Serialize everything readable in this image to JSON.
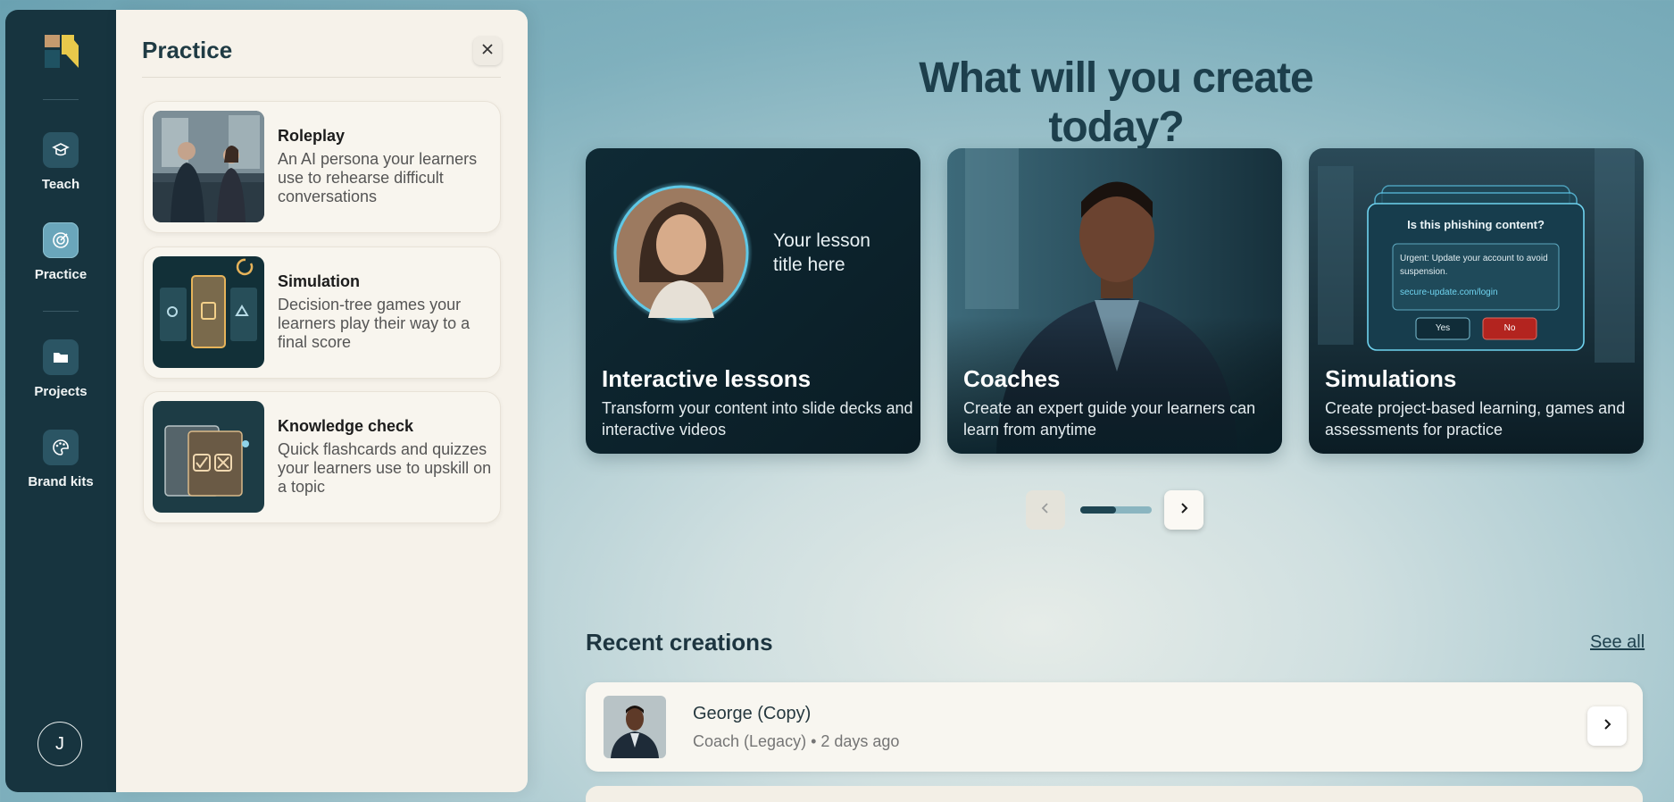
{
  "rail": {
    "items": [
      {
        "label": "Teach",
        "icon": "mortarboard-icon"
      },
      {
        "label": "Practice",
        "icon": "target-icon"
      },
      {
        "label": "Projects",
        "icon": "folder-icon"
      },
      {
        "label": "Brand kits",
        "icon": "palette-icon"
      }
    ],
    "active": "Practice",
    "avatar_initial": "J"
  },
  "panel": {
    "title": "Practice",
    "options": [
      {
        "title": "Roleplay",
        "desc": "An AI persona your learners use to rehearse difficult conversations"
      },
      {
        "title": "Simulation",
        "desc": "Decision-tree games your learners play their way to a final score"
      },
      {
        "title": "Knowledge check",
        "desc": "Quick flashcards and quizzes your learners use to upskill on a topic"
      }
    ]
  },
  "main": {
    "headline": "What will you create today?",
    "cards": [
      {
        "title": "Interactive lessons",
        "desc": "Transform your content into slide decks and interactive videos",
        "overlay": "Your lesson title here"
      },
      {
        "title": "Coaches",
        "desc": "Create an expert guide your learners can learn from anytime"
      },
      {
        "title": "Simulations",
        "desc": "Create project-based learning, games and assessments for practice",
        "mock": {
          "question": "Is this phishing content?",
          "message": "Urgent: Update your account to avoid suspension.",
          "link": "secure-update.com/login",
          "yes": "Yes",
          "no": "No"
        }
      }
    ],
    "pager_progress": 0.5,
    "recent": {
      "title": "Recent creations",
      "see_all": "See all",
      "items": [
        {
          "name": "George (Copy)",
          "meta": "Coach (Legacy) • 2 days ago"
        }
      ]
    }
  },
  "colors": {
    "rail": "#17343f",
    "panel": "#f6f2ea",
    "accent": "#6aa6bb",
    "danger": "#b3241f"
  }
}
